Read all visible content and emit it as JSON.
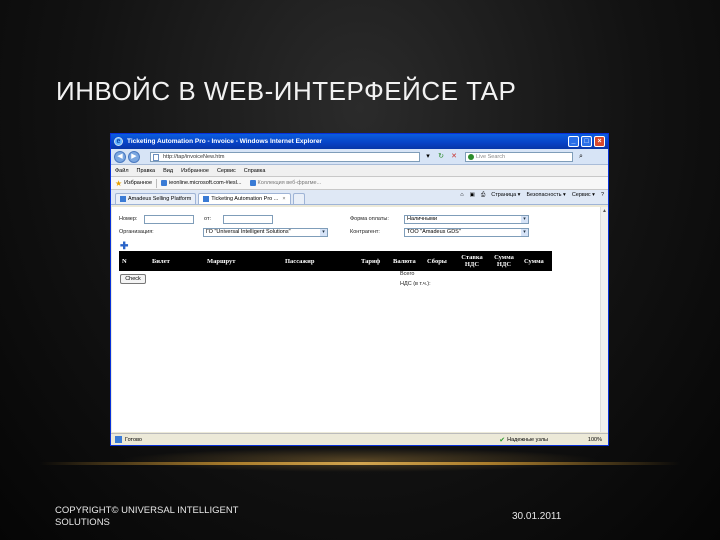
{
  "slide": {
    "title": "ИНВОЙС В WEB-ИНТЕРФЕЙСЕ TAP",
    "footer_copyright": "COPYRIGHT© UNIVERSAL INTELLIGENT SOLUTIONS",
    "footer_date": "30.01.2011",
    "accent_color": "#d4a04a"
  },
  "browser": {
    "window_title": "Ticketing Automation Pro - Invoice - Windows Internet Explorer",
    "address": "http://tap/invoiceNew.htm",
    "search_placeholder": "Live Search",
    "menu": [
      "Файл",
      "Правка",
      "Вид",
      "Избранное",
      "Сервис",
      "Справка"
    ],
    "favorites_label": "Избранное",
    "fav_links": [
      "ieonline.microsoft.com-#iesl...",
      "Коллекция веб-фрагме..."
    ],
    "tabs": [
      {
        "label": "Amadeus Selling Platform"
      },
      {
        "label": "Ticketing Automation Pro ..."
      }
    ],
    "tab_tools": [
      "Страница ▾",
      "Безопасность ▾",
      "Сервис ▾"
    ],
    "status_text": "Готово",
    "status_zone": "Надежные узлы",
    "status_zoom": "100%"
  },
  "form": {
    "number_label": "Номер:",
    "from_label": "от:",
    "org_label": "Организация:",
    "org_value": "ГО \"Universal Intelligent Solutions\"",
    "payment_label": "Форма оплаты:",
    "payment_value": "Наличными",
    "agent_label": "Контрагент:",
    "agent_value": "ТОО \"Amadeus GDS\""
  },
  "grid": {
    "columns": [
      "N",
      "Билет",
      "Маршрут",
      "Пассажир",
      "Тариф",
      "Валюта",
      "Сборы",
      "Ставка НДС",
      "Сумма НДС",
      "Сумма"
    ]
  },
  "actions": {
    "check_label": "Check"
  },
  "totals": {
    "total_label": "Всего",
    "vat_label": "НДС (в т.ч.):"
  }
}
